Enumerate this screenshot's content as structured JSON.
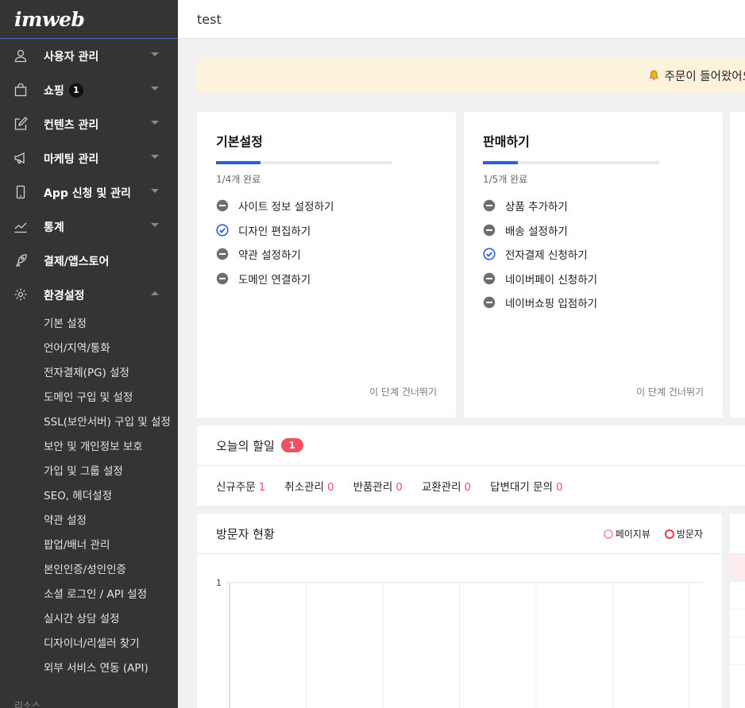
{
  "sidebar": {
    "logo": "imweb",
    "menu": [
      {
        "label": "사용자 관리",
        "icon": "user-icon",
        "caret": "down"
      },
      {
        "label": "쇼핑",
        "icon": "shopping-bag-icon",
        "caret": "down",
        "badge": "1"
      },
      {
        "label": "컨텐츠 관리",
        "icon": "edit-icon",
        "caret": "down"
      },
      {
        "label": "마케팅 관리",
        "icon": "megaphone-icon",
        "caret": "down"
      },
      {
        "label": "App 신청 및 관리",
        "icon": "mobile-icon",
        "caret": "down"
      },
      {
        "label": "통계",
        "icon": "chart-line-icon",
        "caret": "down"
      },
      {
        "label": "결제/앱스토어",
        "icon": "rocket-icon",
        "caret": "none"
      },
      {
        "label": "환경설정",
        "icon": "gear-icon",
        "caret": "up"
      }
    ],
    "submenu": [
      "기본 설정",
      "언어/지역/통화",
      "전자결제(PG) 설정",
      "도메인 구입 및 설정",
      "SSL(보안서버) 구입 및 설정",
      "보안 및 개인정보 보호",
      "가입 및 그룹 설정",
      "SEO, 헤더설정",
      "약관 설정",
      "팝업/배너 관리",
      "본인인증/성인인증",
      "소셜 로그인 / API 설정",
      "실시간 상담 설정",
      "디자이너/리셀러 찾기",
      "외부 서비스 연동 (API)"
    ],
    "footer": "리소스"
  },
  "header": {
    "title": "test"
  },
  "notice": {
    "text": "주문이 들어왔어요",
    "icon": "bell-icon"
  },
  "setup_cards": [
    {
      "title": "기본설정",
      "progress": 0.25,
      "progress_text": "1/4개 완료",
      "tasks": [
        {
          "label": "사이트 정보 설정하기",
          "done": false
        },
        {
          "label": "디자인 편집하기",
          "done": true
        },
        {
          "label": "약관 설정하기",
          "done": false
        },
        {
          "label": "도메인 연결하기",
          "done": false
        }
      ],
      "skip": "이 단계 건너뛰기"
    },
    {
      "title": "판매하기",
      "progress": 0.2,
      "progress_text": "1/5개 완료",
      "tasks": [
        {
          "label": "상품 추가하기",
          "done": false
        },
        {
          "label": "배송 설정하기",
          "done": false
        },
        {
          "label": "전자결제 신청하기",
          "done": true
        },
        {
          "label": "네이버페이 신청하기",
          "done": false
        },
        {
          "label": "네이버쇼핑 입점하기",
          "done": false
        }
      ],
      "skip": "이 단계 건너뛰기"
    }
  ],
  "today": {
    "title": "오늘의 할일",
    "badge": "1",
    "stats": [
      {
        "label": "신규주문",
        "value": "1"
      },
      {
        "label": "취소관리",
        "value": "0"
      },
      {
        "label": "반품관리",
        "value": "0"
      },
      {
        "label": "교환관리",
        "value": "0"
      },
      {
        "label": "답변대기 문의",
        "value": "0"
      }
    ]
  },
  "visitors": {
    "title": "방문자 현황",
    "legend": [
      {
        "label": "페이지뷰",
        "color": "#f7a3ad"
      },
      {
        "label": "방문자",
        "color": "#e8334a"
      }
    ]
  },
  "chart_data": {
    "type": "line",
    "title": "방문자 현황",
    "yticks": [
      "1"
    ],
    "ylim": [
      0,
      1
    ],
    "series": [
      {
        "name": "페이지뷰",
        "values": []
      },
      {
        "name": "방문자",
        "values": []
      }
    ],
    "legend": "top-right",
    "grid": true
  },
  "colors": {
    "accent": "#2a5fd8",
    "sidebar_bg": "#343434",
    "alert": "#f05263",
    "notice_bg": "#fdf2dc"
  }
}
